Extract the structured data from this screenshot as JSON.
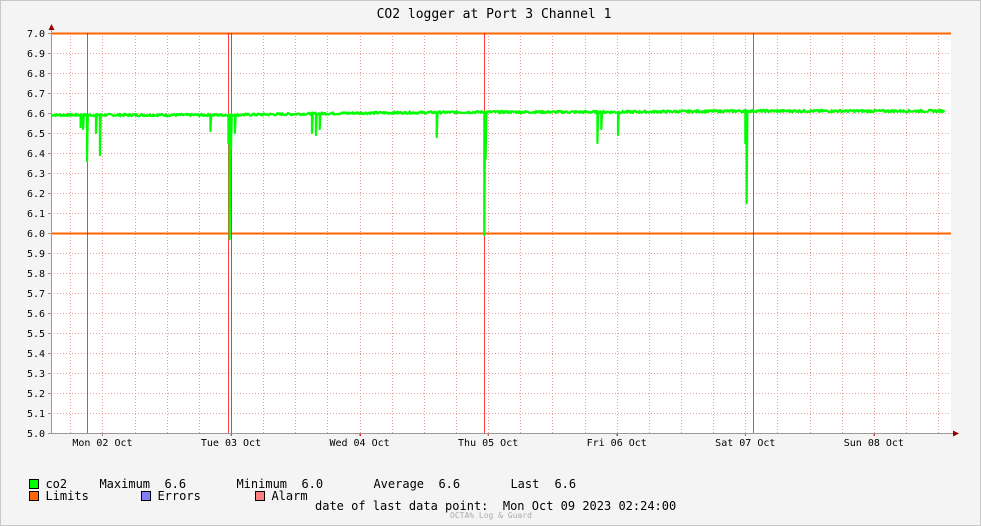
{
  "chart_data": {
    "type": "line",
    "title": "CO2 logger at Port 3 Channel 1",
    "y_ticks": [
      "5.0",
      "5.1",
      "5.2",
      "5.3",
      "5.4",
      "5.5",
      "5.6",
      "5.7",
      "5.8",
      "5.9",
      "6.0",
      "6.1",
      "6.2",
      "6.3",
      "6.4",
      "6.5",
      "6.6",
      "6.7",
      "6.8",
      "6.9",
      "7.0"
    ],
    "ylim": [
      5.0,
      7.0
    ],
    "x_ticks": [
      "Mon 02 Oct",
      "Tue 03 Oct",
      "Wed 04 Oct",
      "Thu 05 Oct",
      "Fri 06 Oct",
      "Sat 07 Oct",
      "Sun 08 Oct"
    ],
    "x_range_days": [
      0.6,
      7.6
    ],
    "grid": true,
    "limits": [
      6.0,
      7.0
    ],
    "alarm_times_days": [
      0.88,
      1.98,
      2.0,
      3.97,
      6.06
    ],
    "series": [
      {
        "name": "co2",
        "color": "#00ff00",
        "baseline": [
          [
            0.6,
            6.59
          ],
          [
            1.0,
            6.59
          ],
          [
            2.0,
            6.59
          ],
          [
            3.0,
            6.6
          ],
          [
            4.0,
            6.605
          ],
          [
            5.0,
            6.605
          ],
          [
            6.0,
            6.61
          ],
          [
            7.6,
            6.61
          ]
        ],
        "dips": [
          [
            0.83,
            6.53
          ],
          [
            0.85,
            6.52
          ],
          [
            0.88,
            6.36
          ],
          [
            0.95,
            6.5
          ],
          [
            0.98,
            6.39
          ],
          [
            1.84,
            6.51
          ],
          [
            1.98,
            6.45
          ],
          [
            1.99,
            5.97
          ],
          [
            2.0,
            6.42
          ],
          [
            2.03,
            6.5
          ],
          [
            2.63,
            6.5
          ],
          [
            2.66,
            6.49
          ],
          [
            2.69,
            6.52
          ],
          [
            3.6,
            6.48
          ],
          [
            3.97,
            5.99
          ],
          [
            3.98,
            6.37
          ],
          [
            4.85,
            6.45
          ],
          [
            4.88,
            6.52
          ],
          [
            5.01,
            6.49
          ],
          [
            6.0,
            6.45
          ],
          [
            6.01,
            6.15
          ]
        ]
      }
    ]
  },
  "legend": {
    "co2_label": "co2",
    "max_label": "Maximum",
    "max_value": "6.6",
    "min_label": "Minimum",
    "min_value": "6.0",
    "avg_label": "Average",
    "avg_value": "6.6",
    "last_label": "Last",
    "last_value": "6.6",
    "limits_label": "Limits",
    "errors_label": "Errors",
    "alarm_label": "Alarm"
  },
  "colors": {
    "co2": "#00ff00",
    "limits": "#ff6600",
    "errors": "#7f7fff",
    "alarm": "#ff7f7f",
    "alarm_line": "#ff0000",
    "grid": "#e5a0a0"
  },
  "footer": {
    "last_point_label": "date of last data point:",
    "last_point_value": "Mon Oct 09 2023 02:24:00",
    "watermark": "OCTA% Log & Guard"
  }
}
